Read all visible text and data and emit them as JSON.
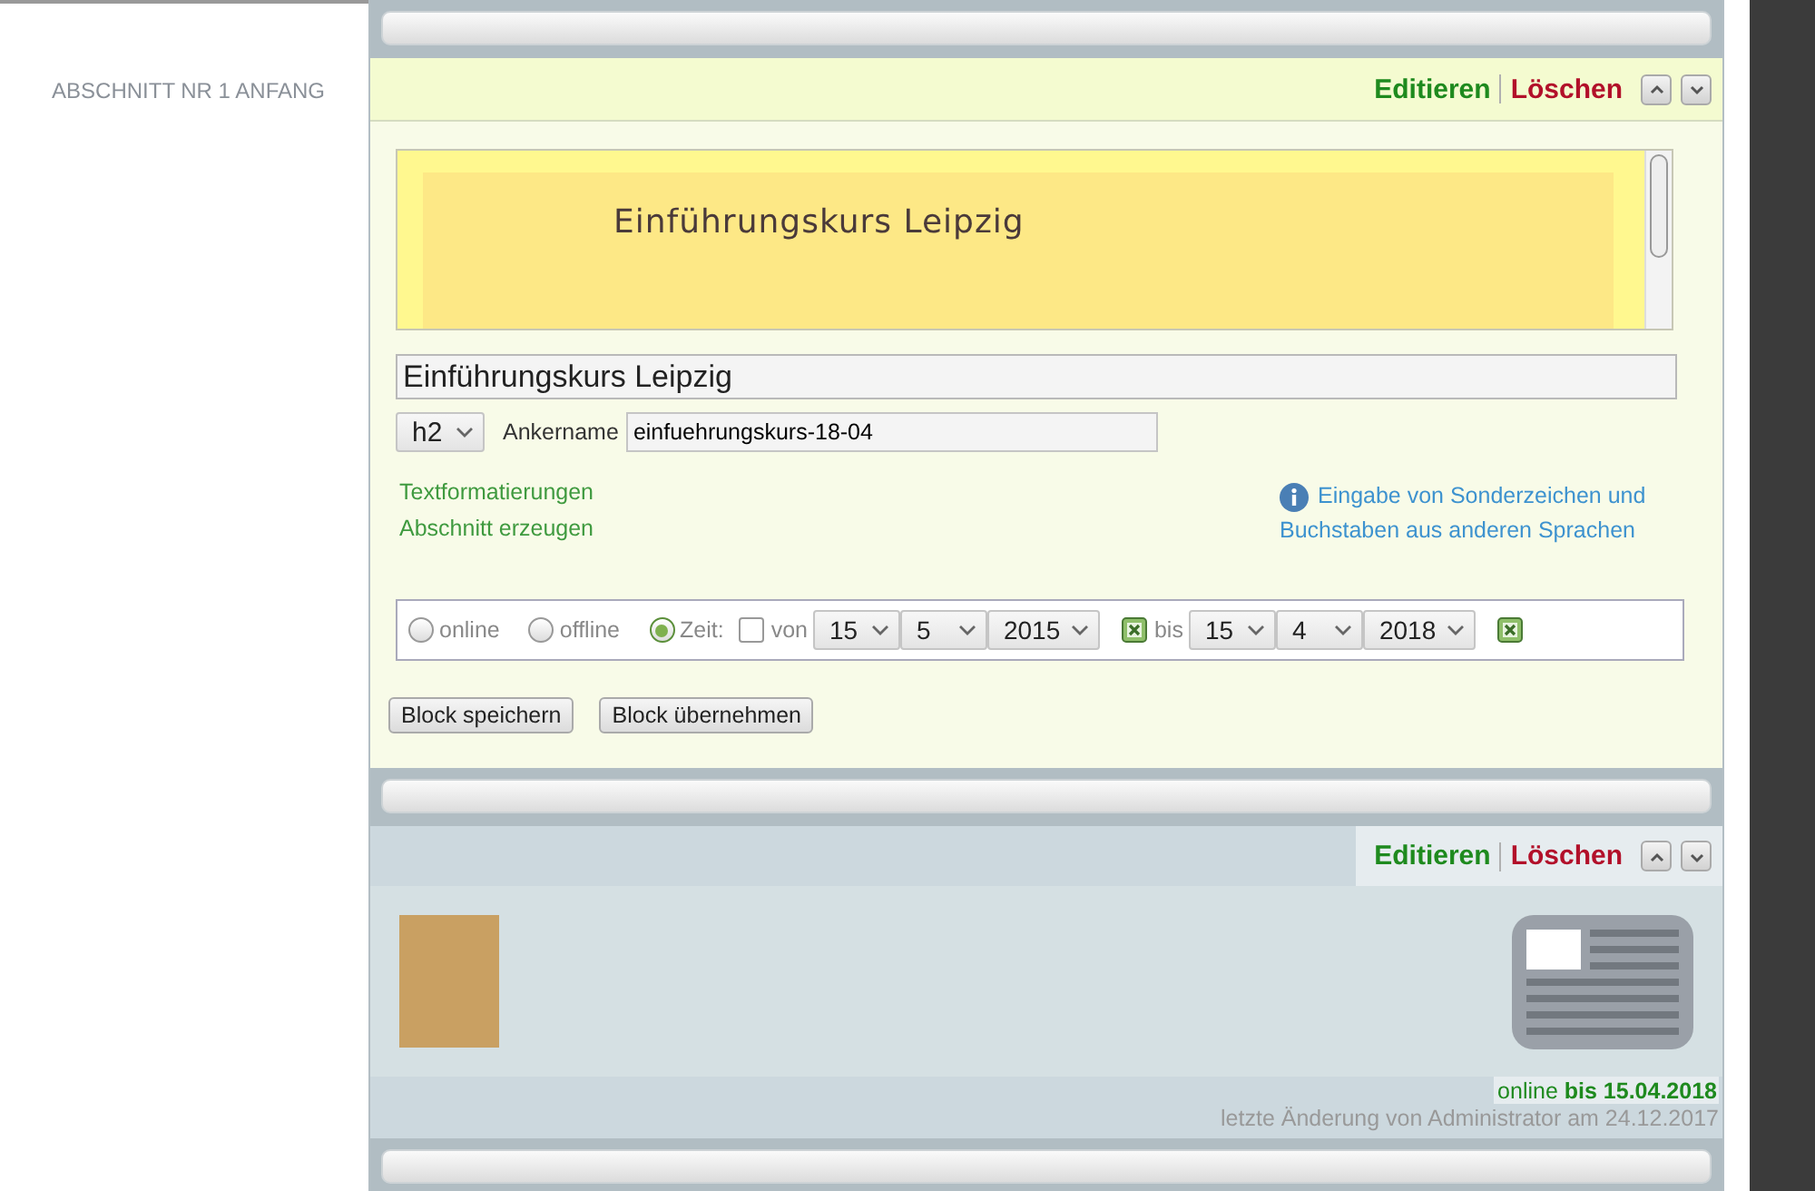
{
  "sidebar": {
    "label": "ABSCHNITT NR 1 ANFANG"
  },
  "editor_block": {
    "actions": [
      {
        "kind": "edit",
        "label": "Editieren"
      },
      {
        "kind": "delete",
        "label": "Löschen"
      }
    ],
    "preview_heading": "Einführungskurs Leipzig",
    "title_value": "Einführungskurs Leipzig",
    "heading_level": "h2",
    "anchor_label": "Ankername",
    "anchor_value": "einfuehrungskurs-18-04",
    "links": [
      "Textformatierungen",
      "Abschnitt erzeugen"
    ],
    "help_link": "Eingabe von Sonderzeichen und Buchstaben aus anderen Sprachen",
    "visibility": [
      {
        "label": "online",
        "selected": false
      },
      {
        "label": "offline",
        "selected": false
      },
      {
        "label": "Zeit:",
        "selected": true
      }
    ],
    "from": {
      "checked": false,
      "label": "von",
      "day": "15",
      "month": "5",
      "year": "2015"
    },
    "to": {
      "label": "bis",
      "day": "15",
      "month": "4",
      "year": "2018"
    },
    "buttons": [
      "Block speichern",
      "Block übernehmen"
    ]
  },
  "teaser_block": {
    "actions": [
      {
        "kind": "edit",
        "label": "Editieren"
      },
      {
        "kind": "delete",
        "label": "Löschen"
      }
    ],
    "status": "online **bis 15.04.2018**",
    "modified": "letzte Änderung von Administrator am 24.12.2017"
  }
}
